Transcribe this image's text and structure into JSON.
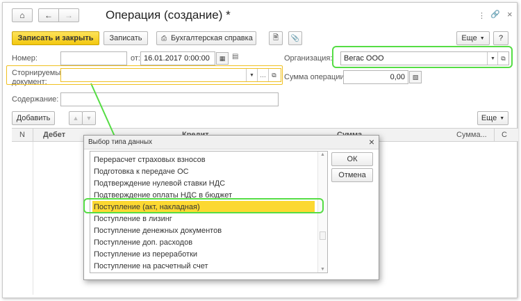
{
  "window": {
    "title": "Операция (создание) *"
  },
  "toolbar": {
    "save_close_label": "Записать и закрыть",
    "save_label": "Записать",
    "accounting_ref_label": "Бухгалтерская справка",
    "more_label": "Еще",
    "help_label": "?"
  },
  "form": {
    "number_label": "Номер:",
    "number_value": "",
    "date_from_label": "от:",
    "date_value": "16.01.2017  0:00:00",
    "org_label": "Организация:",
    "org_value": "Вегас ООО",
    "storno_label_1": "Сторнируемый",
    "storno_label_2": "документ:",
    "storno_value": "",
    "sum_label": "Сумма операции:",
    "sum_value": "0,00",
    "content_label": "Содержание:",
    "content_value": ""
  },
  "table": {
    "add_label": "Добавить",
    "more_label": "Еще",
    "columns": [
      "N",
      "Дебет",
      "Кредит",
      "Сумма",
      "Сумма...",
      "С"
    ]
  },
  "dialog": {
    "title": "Выбор типа данных",
    "ok_label": "ОК",
    "cancel_label": "Отмена",
    "items": [
      "Перерасчет страховых взносов",
      "Подготовка к передаче ОС",
      "Подтверждение нулевой ставки НДС",
      "Подтверждение оплаты НДС в бюджет",
      "Поступление (акт, накладная)",
      "Поступление в лизинг",
      "Поступление денежных документов",
      "Поступление доп. расходов",
      "Поступление из переработки",
      "Поступление на расчетный счет"
    ],
    "selected_index": 4
  },
  "colors": {
    "accent": "#fcd832",
    "highlight": "#55dd44",
    "focus": "#f0c020"
  }
}
